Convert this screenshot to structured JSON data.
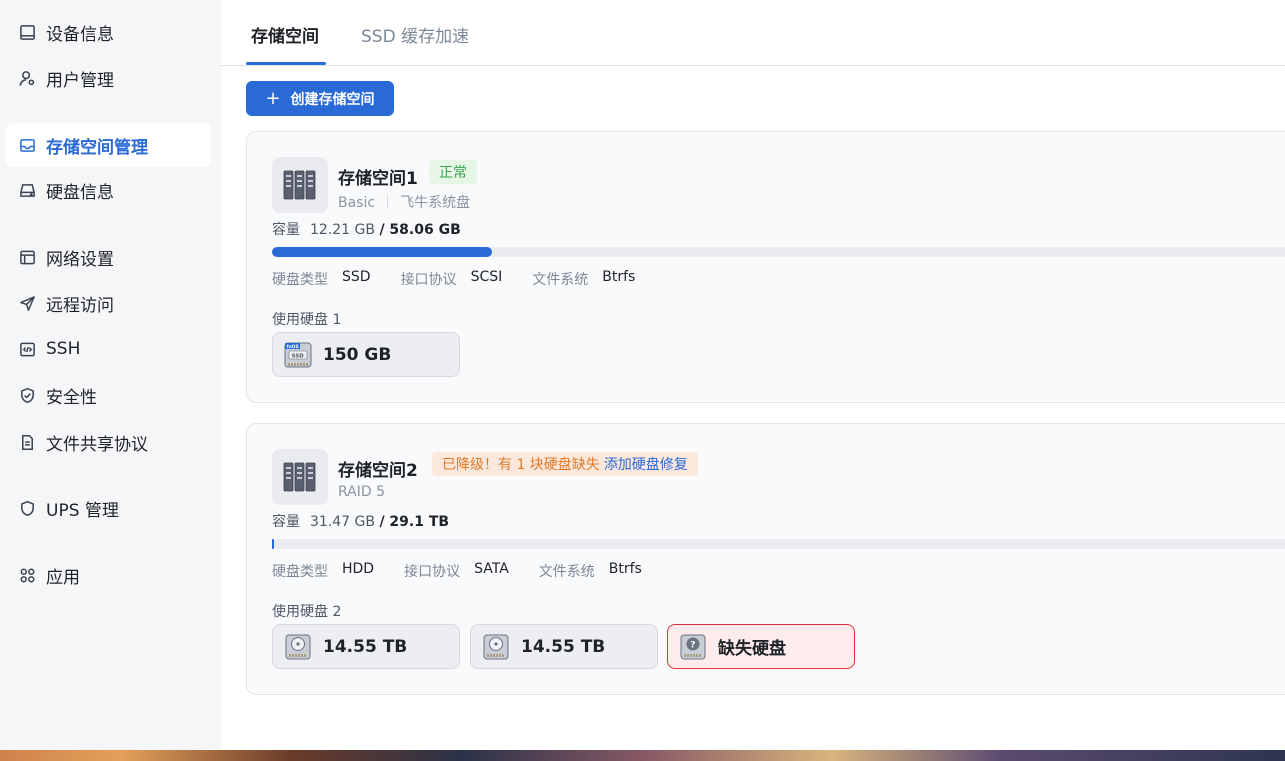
{
  "sidebar": {
    "items": [
      {
        "label": "设备信息",
        "icon": "monitor-icon",
        "active": false
      },
      {
        "label": "用户管理",
        "icon": "user-settings-icon",
        "active": false
      },
      {
        "label": "存储空间管理",
        "icon": "inbox-icon",
        "active": true
      },
      {
        "label": "硬盘信息",
        "icon": "hard-drive-icon",
        "active": false
      },
      {
        "label": "网络设置",
        "icon": "window-icon",
        "active": false
      },
      {
        "label": "远程访问",
        "icon": "send-icon",
        "active": false
      },
      {
        "label": "SSH",
        "icon": "code-icon",
        "active": false
      },
      {
        "label": "安全性",
        "icon": "shield-check-icon",
        "active": false
      },
      {
        "label": "文件共享协议",
        "icon": "document-icon",
        "active": false
      },
      {
        "label": "UPS 管理",
        "icon": "shield-icon",
        "active": false
      },
      {
        "label": "应用",
        "icon": "apps-icon",
        "active": false
      }
    ]
  },
  "tabs": [
    {
      "label": "存储空间",
      "active": true
    },
    {
      "label": "SSD 缓存加速",
      "active": false
    }
  ],
  "create_button": {
    "label": "创建存储空间",
    "icon": "plus-icon"
  },
  "pools": [
    {
      "name": "存储空间1",
      "badge": "正常",
      "type": "Basic",
      "description": "飞牛系统盘",
      "capacity_label": "容量",
      "used": "12.21 GB",
      "total": "/ 58.06 GB",
      "usage_fraction": 0.212,
      "props": [
        {
          "k": "硬盘类型",
          "v": "SSD"
        },
        {
          "k": "接口协议",
          "v": "SCSI"
        },
        {
          "k": "文件系统",
          "v": "Btrfs"
        }
      ],
      "disks_label": "使用硬盘 1",
      "disks": [
        {
          "size": "150 GB",
          "icon": "ssd-icon"
        }
      ]
    },
    {
      "name": "存储空间2",
      "badge": "已降级！有 1 块硬盘缺失",
      "badge_link": "添加硬盘修复",
      "type": "RAID 5",
      "capacity_label": "容量",
      "used": "31.47 GB",
      "total": "/ 29.1 TB",
      "usage_fraction": 0.001,
      "props": [
        {
          "k": "硬盘类型",
          "v": "HDD"
        },
        {
          "k": "接口协议",
          "v": "SATA"
        },
        {
          "k": "文件系统",
          "v": "Btrfs"
        }
      ],
      "disks_label": "使用硬盘 2",
      "disks": [
        {
          "size": "14.55 TB",
          "icon": "hdd-icon"
        },
        {
          "size": "14.55 TB",
          "icon": "hdd-icon"
        },
        {
          "size": "缺失硬盘",
          "icon": "missing-disk-icon"
        }
      ]
    }
  ],
  "colors": {
    "accent": "#2a6ad7",
    "ok": "#3aa34a",
    "warn": "#e07a2a",
    "danger": "#d8333d"
  }
}
